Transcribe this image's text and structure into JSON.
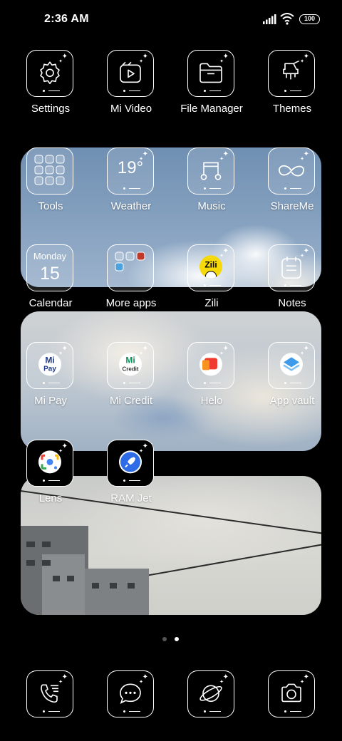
{
  "status": {
    "time": "2:36 AM",
    "battery": "100"
  },
  "rows": {
    "row1": [
      {
        "label": "Settings",
        "icon": "settings-gear-icon"
      },
      {
        "label": "Mi Video",
        "icon": "video-play-icon"
      },
      {
        "label": "File Manager",
        "icon": "folder-icon"
      },
      {
        "label": "Themes",
        "icon": "paint-brush-icon"
      }
    ],
    "row2": [
      {
        "label": "Tools",
        "icon": "tools-folder-icon"
      },
      {
        "label": "Weather",
        "temp": "19°"
      },
      {
        "label": "Music",
        "icon": "music-note-icon"
      },
      {
        "label": "ShareMe",
        "icon": "shareme-infinity-icon"
      }
    ],
    "row3": [
      {
        "label": "Calendar",
        "day": "Monday",
        "date": "15"
      },
      {
        "label": "More apps",
        "icon": "more-apps-folder-icon"
      },
      {
        "label": "Zili",
        "badge_text": "Zili"
      },
      {
        "label": "Notes",
        "icon": "notes-icon"
      }
    ],
    "row4": [
      {
        "label": "Mi Pay",
        "badge_top": "Mi",
        "badge_bottom": "Pay"
      },
      {
        "label": "Mi Credit",
        "badge_top": "Mi",
        "badge_bottom": "Credit"
      },
      {
        "label": "Helo",
        "icon": "helo-icon"
      },
      {
        "label": "App vault",
        "icon": "app-vault-icon"
      }
    ],
    "row5": [
      {
        "label": "Lens",
        "icon": "google-lens-icon"
      },
      {
        "label": "RAM Jet",
        "icon": "rocket-icon"
      }
    ]
  },
  "dock": [
    {
      "name": "phone",
      "icon": "phone-icon"
    },
    {
      "name": "messages",
      "icon": "message-icon"
    },
    {
      "name": "browser",
      "icon": "browser-planet-icon"
    },
    {
      "name": "camera",
      "icon": "camera-icon"
    }
  ],
  "page_indicator": {
    "count": 2,
    "active": 2
  },
  "colors": {
    "mi_orange": "#ff6900",
    "zili_yellow": "#f5d90a",
    "helo_red": "#ef3b2f",
    "vault_blue": "#3d9be9"
  }
}
